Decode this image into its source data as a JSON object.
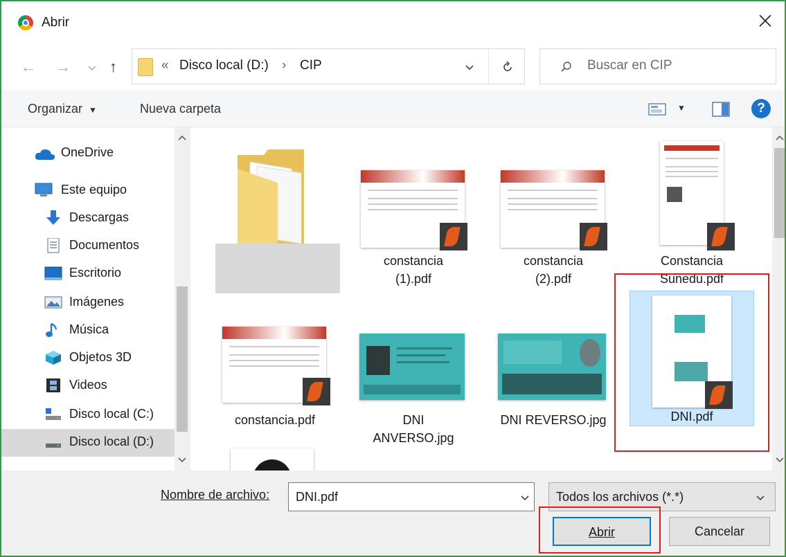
{
  "window": {
    "title": "Abrir"
  },
  "address": {
    "crumbs": [
      "«",
      "Disco local (D:)",
      "›",
      "CIP"
    ]
  },
  "search": {
    "placeholder": "Buscar en CIP"
  },
  "toolbar": {
    "organize": "Organizar",
    "new_folder": "Nueva carpeta"
  },
  "sidebar": {
    "items": [
      {
        "label": "OneDrive",
        "icon": "cloud-icon"
      },
      {
        "label": "Este equipo",
        "icon": "computer-icon"
      },
      {
        "label": "Descargas",
        "icon": "download-arrow-icon"
      },
      {
        "label": "Documentos",
        "icon": "document-icon"
      },
      {
        "label": "Escritorio",
        "icon": "desktop-icon"
      },
      {
        "label": "Imágenes",
        "icon": "pictures-icon"
      },
      {
        "label": "Música",
        "icon": "music-note-icon"
      },
      {
        "label": "Objetos 3D",
        "icon": "cube-icon"
      },
      {
        "label": "Videos",
        "icon": "film-icon"
      },
      {
        "label": "Disco local (C:)",
        "icon": "drive-icon"
      },
      {
        "label": "Disco local (D:)",
        "icon": "drive-icon"
      }
    ],
    "selected": "Disco local (D:)"
  },
  "files": [
    {
      "name": "",
      "type": "folder"
    },
    {
      "name": "constancia (1).pdf",
      "line1": "constancia",
      "line2": "(1).pdf",
      "type": "pdf"
    },
    {
      "name": "constancia (2).pdf",
      "line1": "constancia",
      "line2": "(2).pdf",
      "type": "pdf"
    },
    {
      "name": "Constancia Sunedu.pdf",
      "line1": "Constancia",
      "line2": "Sunedu.pdf",
      "type": "pdf"
    },
    {
      "name": "constancia.pdf",
      "line1": "constancia.pdf",
      "line2": "",
      "type": "pdf"
    },
    {
      "name": "DNI ANVERSO.jpg",
      "line1": "DNI",
      "line2": "ANVERSO.jpg",
      "type": "jpg"
    },
    {
      "name": "DNI REVERSO.jpg",
      "line1": "DNI REVERSO.jpg",
      "line2": "",
      "type": "jpg"
    },
    {
      "name": "DNI.pdf",
      "line1": "DNI.pdf",
      "line2": "",
      "type": "pdf",
      "selected": true
    }
  ],
  "bottom": {
    "filename_label": "Nombre de archivo:",
    "filename_value": "DNI.pdf",
    "filetype": "Todos los archivos (*.*)",
    "open": "Abrir",
    "cancel": "Cancelar"
  },
  "colors": {
    "frame": "#2a9d46",
    "selection": "#cce8ff",
    "highlight": "#e01b1b",
    "accent": "#0078d7"
  }
}
